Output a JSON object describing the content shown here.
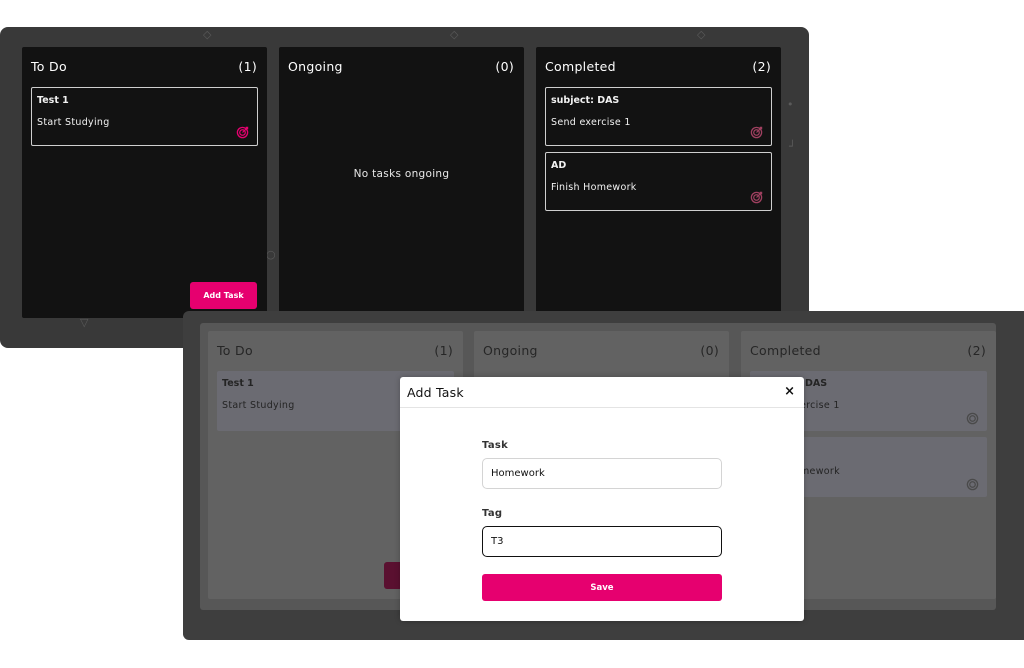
{
  "back_board": {
    "columns": [
      {
        "title": "To Do",
        "count": "(1)",
        "cards": [
          {
            "tag": "Test 1",
            "task": "Start Studying"
          }
        ],
        "add_button_label": "Add Task"
      },
      {
        "title": "Ongoing",
        "count": "(0)",
        "empty_message": "No tasks ongoing"
      },
      {
        "title": "Completed",
        "count": "(2)",
        "cards": [
          {
            "tag": "subject: DAS",
            "task": "Send exercise 1"
          },
          {
            "tag": "AD",
            "task": "Finish Homework"
          }
        ]
      }
    ]
  },
  "front_board": {
    "columns": [
      {
        "title": "To Do",
        "count": "(1)",
        "cards": [
          {
            "tag": "Test 1",
            "task": "Start Studying"
          }
        ]
      },
      {
        "title": "Ongoing",
        "count": "(0)"
      },
      {
        "title": "Completed",
        "count": "(2)",
        "cards": [
          {
            "tag_visible": "DAS",
            "task_visible": "ercise 1"
          },
          {
            "task_visible": "mework"
          }
        ]
      }
    ]
  },
  "modal": {
    "title": "Add Task",
    "close_symbol": "×",
    "task_label": "Task",
    "task_value": "Homework",
    "tag_label": "Tag",
    "tag_value": "T3",
    "save_label": "Save"
  },
  "icons": {
    "card_action": "target-icon"
  },
  "colors": {
    "accent": "#e6006f",
    "target_icon_active": "#e6006f",
    "target_icon_done": "#a04060",
    "dark_panel": "#121212",
    "backdrop": "#393939"
  }
}
